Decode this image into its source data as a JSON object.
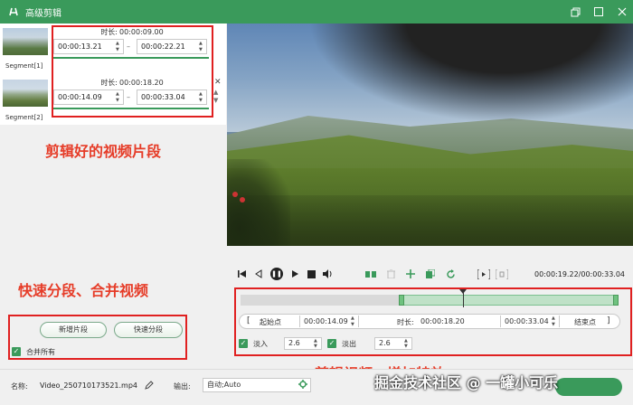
{
  "window": {
    "title": "高级剪辑",
    "icons": {
      "app": "app-icon",
      "restore": "restore-icon",
      "maximize": "maximize-icon",
      "close": "close-icon"
    }
  },
  "segments": [
    {
      "label": "Segment[1]",
      "duration_label": "时长:",
      "duration": "00:00:09.00",
      "start": "00:00:13.21",
      "end": "00:00:22.21"
    },
    {
      "label": "Segment[2]",
      "duration_label": "时长:",
      "duration": "00:00:18.20",
      "start": "00:00:14.09",
      "end": "00:00:33.04"
    }
  ],
  "segment_controls": {
    "close_glyph": "✕",
    "up_glyph": "▲",
    "down_glyph": "▼"
  },
  "annotations": {
    "segments_note": "剪辑好的视频片段",
    "split_note": "快速分段、合并视频",
    "edit_note": "剪辑视频、增加特效"
  },
  "left_buttons": {
    "add_segment": "新增片段",
    "quick_split": "快速分段"
  },
  "merge_all": {
    "label": "合并所有",
    "checked": true
  },
  "player": {
    "timecode": "00:00:19.22/00:00:33.04",
    "icons": [
      "skip-start-icon",
      "step-back-icon",
      "pause-icon",
      "play-icon",
      "stop-icon",
      "volume-icon",
      "split-icon",
      "delete-icon",
      "add-icon",
      "copy-icon",
      "rotate-icon",
      "snapshot-icon",
      "crop-icon"
    ]
  },
  "timeline": {
    "selection_start": 0.42,
    "selection_end": 0.99,
    "playhead": 0.58
  },
  "range": {
    "start_label": "起始点",
    "start": "00:00:14.09",
    "duration_label": "时长:",
    "duration": "00:00:18.20",
    "end": "00:00:33.04",
    "end_label": "结束点",
    "open_bracket": "[",
    "close_bracket": "]"
  },
  "fade": {
    "in_label": "淡入",
    "in_value": "2.6",
    "out_label": "淡出",
    "out_value": "2.6",
    "in_checked": true,
    "out_checked": true
  },
  "bottom": {
    "name_label": "名称:",
    "name": "Video_250710173521.mp4",
    "output_label": "输出:",
    "output": "自动;Auto"
  },
  "watermark": "掘金技术社区 @ 一罐小可乐",
  "colors": {
    "accent": "#3a9a5b",
    "annotation": "#e63c28",
    "annotation_box": "#e02020"
  }
}
